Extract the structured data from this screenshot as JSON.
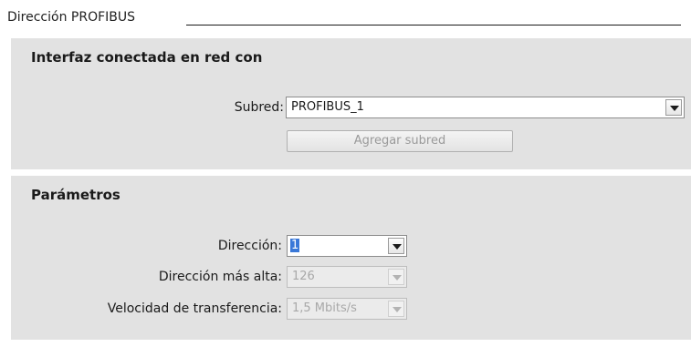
{
  "header": {
    "title": "Dirección PROFIBUS"
  },
  "network": {
    "title": "Interfaz conectada en red con",
    "subnet_label": "Subred:",
    "subnet_value": "PROFIBUS_1",
    "add_subnet_label": "Agregar subred"
  },
  "params": {
    "title": "Parámetros",
    "address_label": "Dirección:",
    "address_value": "1",
    "highest_label": "Dirección más alta:",
    "highest_value": "126",
    "speed_label": "Velocidad de transferencia:",
    "speed_value": "1,5 Mbits/s"
  },
  "icons": {
    "dropdown": "chevron-down-icon"
  },
  "colors": {
    "section_bg": "#e2e2e2",
    "selection": "#3a78d8"
  }
}
